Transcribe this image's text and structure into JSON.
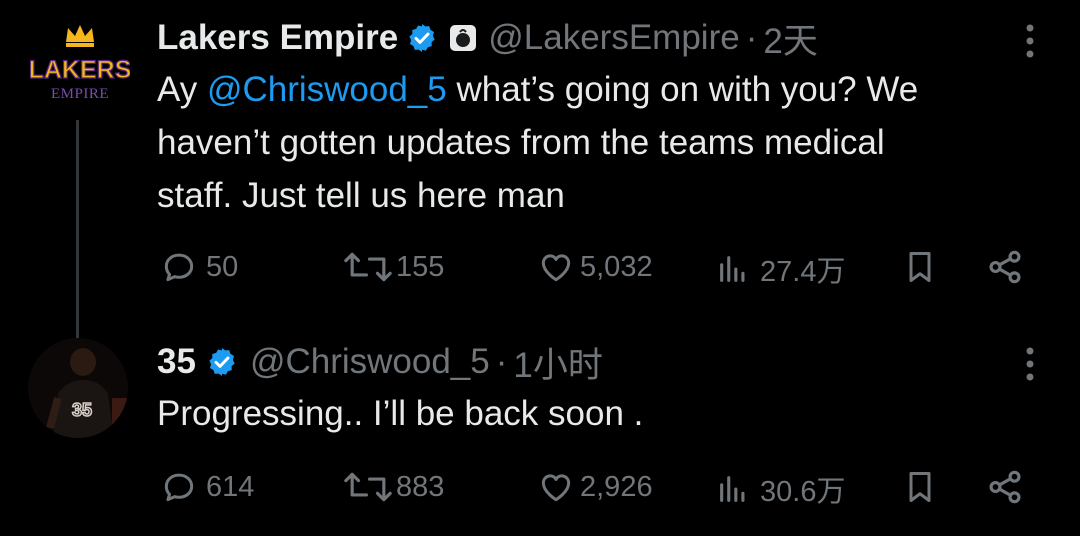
{
  "tweets": [
    {
      "author_name": "Lakers Empire",
      "handle": "@LakersEmpire",
      "separator": "·",
      "time": "2天",
      "avatar": {
        "logo_top": "LAKERS",
        "logo_bottom": "EMPIRE"
      },
      "text_prefix": "Ay ",
      "mention": "@Chriswood_5",
      "text_line1_rest": " what’s going on with you? We",
      "text_line2": "haven’t gotten updates from the teams medical",
      "text_line3": "staff. Just tell us here man",
      "replies": "50",
      "retweets": "155",
      "likes": "5,032",
      "views": "27.4万"
    },
    {
      "author_name": "35",
      "handle": "@Chriswood_5",
      "separator": "·",
      "time": "1小时",
      "text": "Progressing.. I’ll be back soon .",
      "replies": "614",
      "retweets": "883",
      "likes": "2,926",
      "views": "30.6万"
    }
  ],
  "colors": {
    "background": "#000000",
    "text": "#e7e9ea",
    "muted": "#71767b",
    "accent": "#1d9bf0",
    "verified": "#1d9bf0",
    "logo_gold": "#f5b51c",
    "logo_purple": "#552583"
  }
}
